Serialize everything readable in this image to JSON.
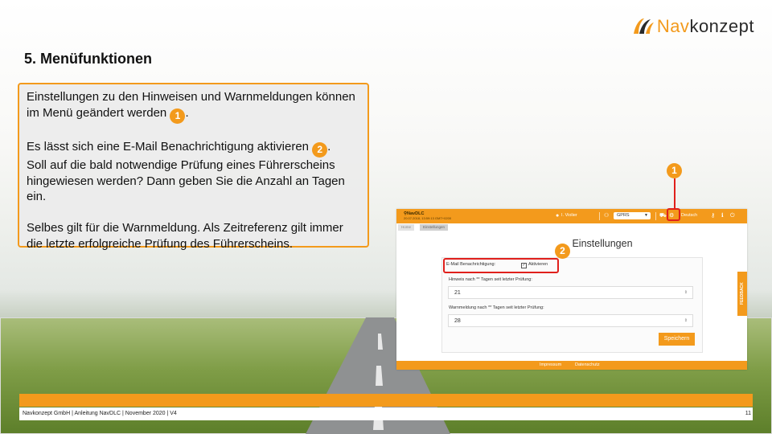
{
  "logo": {
    "nav": "Nav",
    "konzept": "konzept"
  },
  "slide_title": "5. Menüfunktionen",
  "textbox": {
    "p1_text": "Einstellungen zu den Hinweisen und Warnmeldungen können im Menü geändert werden ",
    "p1_badge": "1",
    "p1_end": ".",
    "p2a_text": "Es lässt sich eine E-Mail Benachrichtigung aktivieren ",
    "p2a_badge": "2",
    "p2a_end": ".",
    "p2b_text": "Soll auf die bald notwendige Prüfung eines Führerscheins hingewiesen werden? Dann geben Sie die Anzahl an Tagen ein.",
    "p3_text": "Selbes gilt für die Warnmeldung. Als Zeitreferenz gilt immer die letzte erfolgreiche Prüfung des Führerscheins."
  },
  "app": {
    "brand": "NavDLC",
    "brand_sub": "20.07.2018, 13:59:13 GMT+0200",
    "user": "I. Violier",
    "network_select": "GPRS",
    "language": "Deutsch",
    "breadcrumb": {
      "home": "Home",
      "current": "Einstellungen"
    },
    "page_title": "Einstellungen",
    "email_label": "E-Mail Benachrichtigung:",
    "email_checkbox_label": "Aktivieren",
    "email_checked": true,
    "hint_label": "Hinweis nach ** Tagen seit letzter Prüfung:",
    "hint_value": "21",
    "warn_label": "Warnmeldung nach ** Tagen seit letzter Prüfung:",
    "warn_value": "28",
    "save_label": "Speichern",
    "feedback_label": "FEEDBACK",
    "footer": {
      "impressum": "Impressum",
      "datenschutz": "Datenschutz"
    }
  },
  "callouts": {
    "one": "1",
    "two": "2"
  },
  "footer": {
    "text": "Navkonzept GmbH  |  Anleitung NavDLC  |  November 2020  |  V4",
    "page": "11"
  },
  "colors": {
    "accent": "#f39a1c",
    "highlight": "#e0201c"
  }
}
